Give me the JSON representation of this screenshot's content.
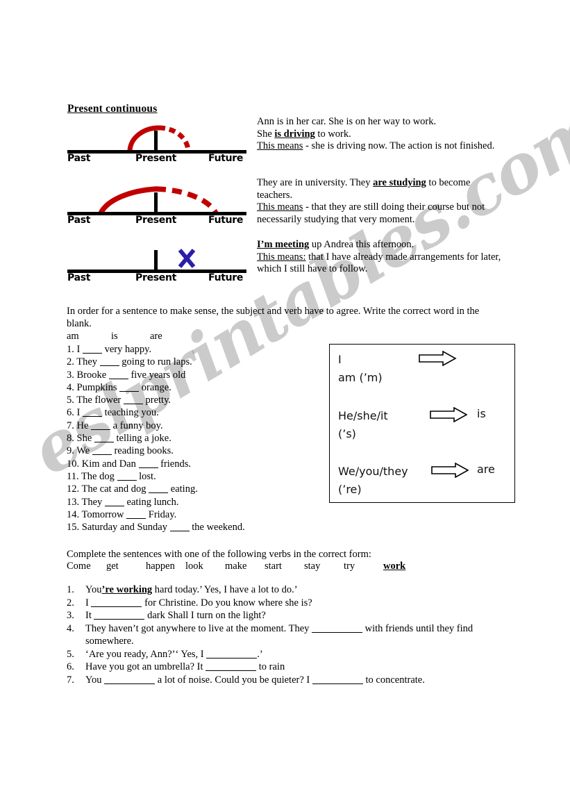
{
  "heading": "Present continuous",
  "watermark": "eslprintables.com",
  "colors": {
    "arc": "#C00000",
    "cross": "#2A1FA8",
    "axis": "#000000"
  },
  "timelines": [
    {
      "past": "Past",
      "present": "Present",
      "future": "Future",
      "marker": "arc-narrow"
    },
    {
      "past": "Past",
      "present": "Present",
      "future": "Future",
      "marker": "arc-wide"
    },
    {
      "past": "Past",
      "present": "Present",
      "future": "Future",
      "marker": "cross"
    }
  ],
  "explanations": [
    {
      "line1_a": "Ann is in her car. She is on her way to work.",
      "line2_a": "She ",
      "line2_bold": "is driving",
      "line2_b": " to work.",
      "line3_u": "This means",
      "line3_a": " - she is driving now.  The action is not finished."
    },
    {
      "line1_a": "They are in university. They ",
      "line1_bold": "are studying",
      "line1_b": " to become teachers.",
      "line3_u": "This means",
      "line3_a": " - that they are still doing their course but not necessarily studying that very moment."
    },
    {
      "line1_bold": "I’m meeting",
      "line1_b": " up Andrea this afternoon.",
      "line3_u": "This means:",
      "line3_a": " that I have already made arrangements for later, which I still have to follow."
    }
  ],
  "exercise1": {
    "instruction": "In order for a sentence to make sense, the subject and verb have to agree. Write the correct word in the blank.",
    "word_bank": [
      "am",
      "is",
      "are"
    ],
    "items": [
      {
        "num": "1.",
        "before": "I",
        "after": "very happy."
      },
      {
        "num": "2.",
        "before": "They",
        "after": "going to run laps."
      },
      {
        "num": "3.",
        "before": "Brooke",
        "after": "five years old"
      },
      {
        "num": "4.",
        "before": "Pumpkins",
        "after": "orange."
      },
      {
        "num": "5.",
        "before": "The flower",
        "after": "pretty."
      },
      {
        "num": "6.",
        "before": "I",
        "after": "teaching you."
      },
      {
        "num": "7.",
        "before": "He",
        "after": "a funny boy."
      },
      {
        "num": "8.",
        "before": "She",
        "after": "telling a joke."
      },
      {
        "num": "9.",
        "before": "We",
        "after": "reading books."
      },
      {
        "num": "10.",
        "before": "Kim and Dan",
        "after": "friends."
      },
      {
        "num": "11.",
        "before": "The dog",
        "after": "lost."
      },
      {
        "num": "12.",
        "before": "The cat and dog",
        "after": "eating."
      },
      {
        "num": "13.",
        "before": "They",
        "after": "eating lunch."
      },
      {
        "num": "14.",
        "before": "Tomorrow",
        "after": "Friday."
      },
      {
        "num": "15.",
        "before": "Saturday and Sunday",
        "after": "the weekend."
      }
    ]
  },
  "pronoun_box": {
    "rows": [
      {
        "subject": "I\nam (’m)",
        "arrow": "right-arrow-icon",
        "verb": ""
      },
      {
        "subject": "He/she/it\n(’s)",
        "arrow": "right-arrow-icon",
        "verb": "is"
      },
      {
        "subject": "We/you/they\n(’re)",
        "arrow": "right-arrow-icon",
        "verb": "are"
      }
    ]
  },
  "exercise2": {
    "instruction": "Complete the sentences with one of the following verbs in the correct form:",
    "verb_bank": [
      "Come",
      "get",
      "happen",
      "look",
      "make",
      "start",
      "stay",
      "try"
    ],
    "verb_bank_answer": "work",
    "items": [
      {
        "num": "1.",
        "parts": [
          {
            "t": "You",
            "type": "text"
          },
          {
            "t": "’re working",
            "type": "answer"
          },
          {
            "t": " hard today.’ Yes, I have a lot to do.’",
            "type": "text"
          }
        ]
      },
      {
        "num": "2.",
        "parts": [
          {
            "t": "I ",
            "type": "text"
          },
          {
            "t": "",
            "type": "blank"
          },
          {
            "t": " for Christine. Do you know where she is?",
            "type": "text"
          }
        ]
      },
      {
        "num": "3.",
        "parts": [
          {
            "t": "It ",
            "type": "text"
          },
          {
            "t": "",
            "type": "blank"
          },
          {
            "t": " dark  Shall I turn on the light?",
            "type": "text"
          }
        ]
      },
      {
        "num": "4.",
        "parts": [
          {
            "t": "They haven’t got anywhere to live at the moment. They ",
            "type": "text"
          },
          {
            "t": "",
            "type": "blank"
          },
          {
            "t": " with friends until they find somewhere.",
            "type": "text"
          }
        ]
      },
      {
        "num": "5.",
        "parts": [
          {
            "t": "‘Are you ready, Ann?’‘ Yes, I ",
            "type": "text"
          },
          {
            "t": "",
            "type": "blank"
          },
          {
            "t": ".’",
            "type": "text"
          }
        ]
      },
      {
        "num": "6.",
        "parts": [
          {
            "t": "Have you got an umbrella? It ",
            "type": "text"
          },
          {
            "t": "",
            "type": "blank"
          },
          {
            "t": " to rain",
            "type": "text"
          }
        ]
      },
      {
        "num": "7.",
        "parts": [
          {
            "t": "You ",
            "type": "text"
          },
          {
            "t": "",
            "type": "blank"
          },
          {
            "t": " a lot of noise. Could you be quieter? I ",
            "type": "text"
          },
          {
            "t": "",
            "type": "blank"
          },
          {
            "t": " to concentrate.",
            "type": "text"
          }
        ]
      }
    ]
  }
}
